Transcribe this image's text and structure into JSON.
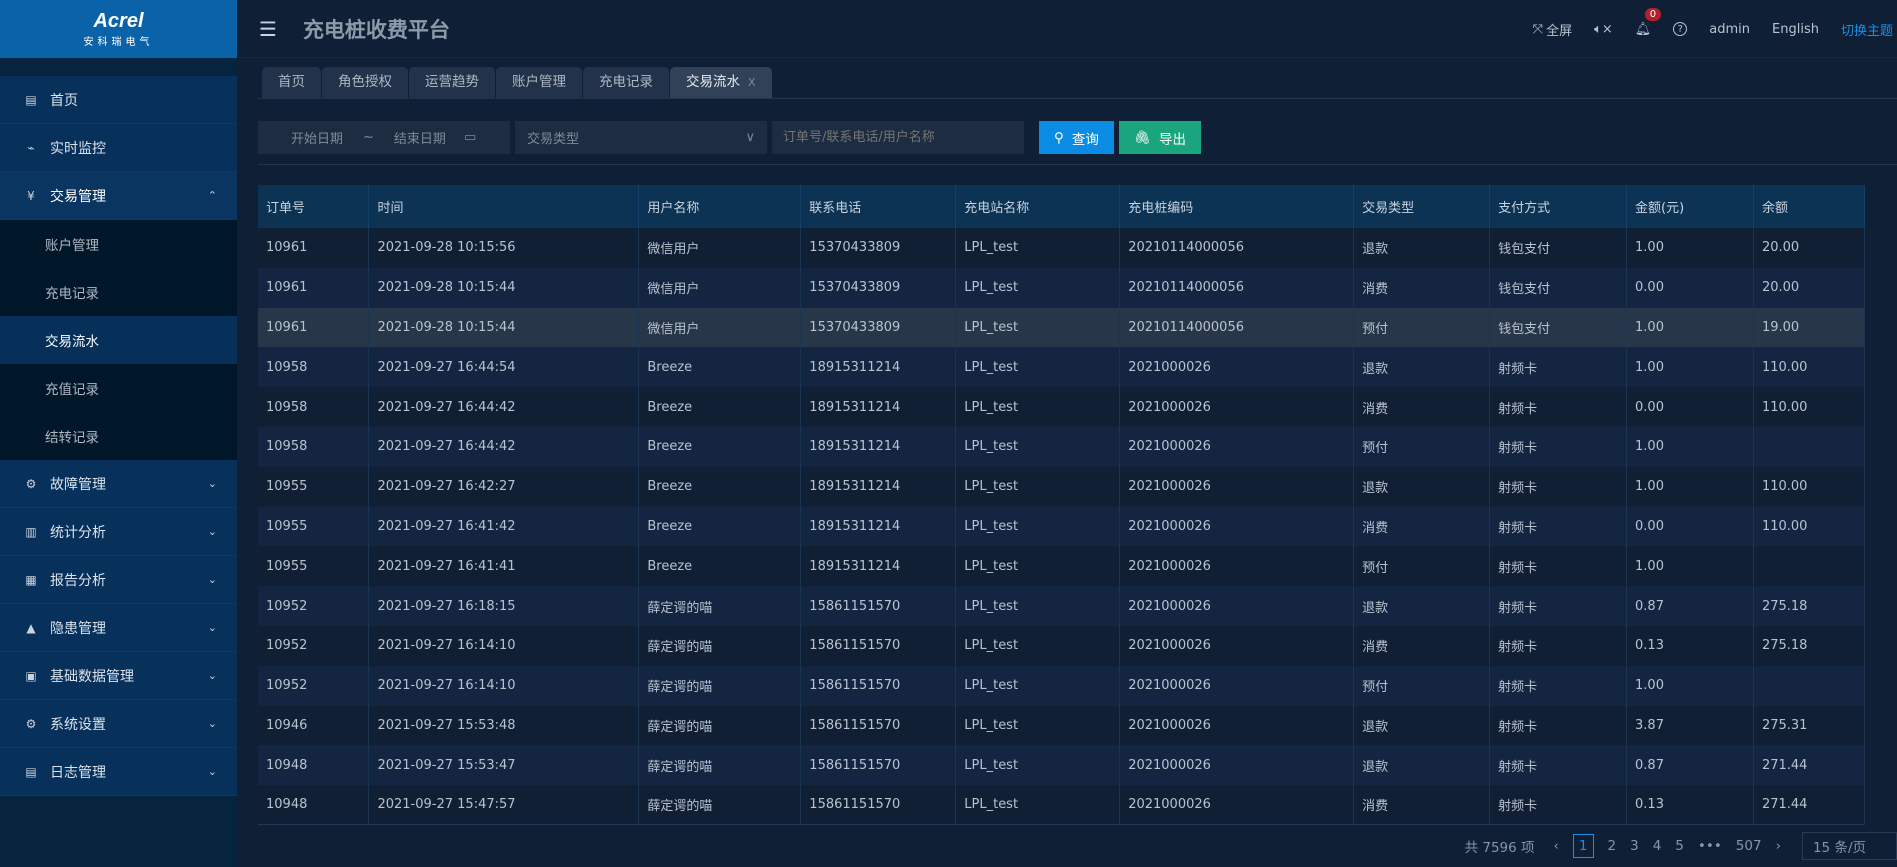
{
  "logo": {
    "brand": "Acrel",
    "sub": "安科瑞电气"
  },
  "sidebar": {
    "items": [
      {
        "label": "首页",
        "icon": "monitor-icon"
      },
      {
        "label": "实时监控",
        "icon": "pulse-icon"
      },
      {
        "label": "交易管理",
        "icon": "yen-icon",
        "open": true,
        "children": [
          "账户管理",
          "充电记录",
          "交易流水",
          "充值记录",
          "结转记录"
        ],
        "active_child": "交易流水"
      },
      {
        "label": "故障管理",
        "icon": "fault-icon"
      },
      {
        "label": "统计分析",
        "icon": "bar-chart-icon"
      },
      {
        "label": "报告分析",
        "icon": "report-icon"
      },
      {
        "label": "隐患管理",
        "icon": "warning-icon"
      },
      {
        "label": "基础数据管理",
        "icon": "database-icon"
      },
      {
        "label": "系统设置",
        "icon": "gears-icon"
      },
      {
        "label": "日志管理",
        "icon": "log-icon"
      }
    ]
  },
  "header": {
    "title": "充电桩收费平台",
    "fullscreen": "全屏",
    "notifications": "0",
    "user": "admin",
    "language": "English",
    "theme": "切换主题"
  },
  "tabs": [
    "首页",
    "角色授权",
    "运营趋势",
    "账户管理",
    "充电记录",
    "交易流水"
  ],
  "filters": {
    "start_placeholder": "开始日期",
    "sep": "~",
    "end_placeholder": "结束日期",
    "type_placeholder": "交易类型",
    "keyword_placeholder": "订单号/联系电话/用户名称",
    "query": "查询",
    "export": "导出"
  },
  "table": {
    "columns": [
      "订单号",
      "时间",
      "用户名称",
      "联系电话",
      "充电站名称",
      "充电桩编码",
      "交易类型",
      "支付方式",
      "金额(元)",
      "余额"
    ],
    "rows": [
      [
        "10961",
        "2021-09-28 10:15:56",
        "微信用户",
        "15370433809",
        "LPL_test",
        "20210114000056",
        "退款",
        "钱包支付",
        "1.00",
        "20.00"
      ],
      [
        "10961",
        "2021-09-28 10:15:44",
        "微信用户",
        "15370433809",
        "LPL_test",
        "20210114000056",
        "消费",
        "钱包支付",
        "0.00",
        "20.00"
      ],
      [
        "10961",
        "2021-09-28 10:15:44",
        "微信用户",
        "15370433809",
        "LPL_test",
        "20210114000056",
        "预付",
        "钱包支付",
        "1.00",
        "19.00"
      ],
      [
        "10958",
        "2021-09-27 16:44:54",
        "Breeze",
        "18915311214",
        "LPL_test",
        "2021000026",
        "退款",
        "射频卡",
        "1.00",
        "110.00"
      ],
      [
        "10958",
        "2021-09-27 16:44:42",
        "Breeze",
        "18915311214",
        "LPL_test",
        "2021000026",
        "消费",
        "射频卡",
        "0.00",
        "110.00"
      ],
      [
        "10958",
        "2021-09-27 16:44:42",
        "Breeze",
        "18915311214",
        "LPL_test",
        "2021000026",
        "预付",
        "射频卡",
        "1.00",
        ""
      ],
      [
        "10955",
        "2021-09-27 16:42:27",
        "Breeze",
        "18915311214",
        "LPL_test",
        "2021000026",
        "退款",
        "射频卡",
        "1.00",
        "110.00"
      ],
      [
        "10955",
        "2021-09-27 16:41:42",
        "Breeze",
        "18915311214",
        "LPL_test",
        "2021000026",
        "消费",
        "射频卡",
        "0.00",
        "110.00"
      ],
      [
        "10955",
        "2021-09-27 16:41:41",
        "Breeze",
        "18915311214",
        "LPL_test",
        "2021000026",
        "预付",
        "射频卡",
        "1.00",
        ""
      ],
      [
        "10952",
        "2021-09-27 16:18:15",
        "薛定谔的喵",
        "15861151570",
        "LPL_test",
        "2021000026",
        "退款",
        "射频卡",
        "0.87",
        "275.18"
      ],
      [
        "10952",
        "2021-09-27 16:14:10",
        "薛定谔的喵",
        "15861151570",
        "LPL_test",
        "2021000026",
        "消费",
        "射频卡",
        "0.13",
        "275.18"
      ],
      [
        "10952",
        "2021-09-27 16:14:10",
        "薛定谔的喵",
        "15861151570",
        "LPL_test",
        "2021000026",
        "预付",
        "射频卡",
        "1.00",
        ""
      ],
      [
        "10946",
        "2021-09-27 15:53:48",
        "薛定谔的喵",
        "15861151570",
        "LPL_test",
        "2021000026",
        "退款",
        "射频卡",
        "3.87",
        "275.31"
      ],
      [
        "10948",
        "2021-09-27 15:53:47",
        "薛定谔的喵",
        "15861151570",
        "LPL_test",
        "2021000026",
        "退款",
        "射频卡",
        "0.87",
        "271.44"
      ],
      [
        "10948",
        "2021-09-27 15:47:57",
        "薛定谔的喵",
        "15861151570",
        "LPL_test",
        "2021000026",
        "消费",
        "射频卡",
        "0.13",
        "271.44"
      ]
    ]
  },
  "pagination": {
    "total": "共 7596 项",
    "pages": [
      "1",
      "2",
      "3",
      "4",
      "5"
    ],
    "ellipsis": "•••",
    "last": "507",
    "current": "1",
    "page_size": "15 条/页"
  }
}
